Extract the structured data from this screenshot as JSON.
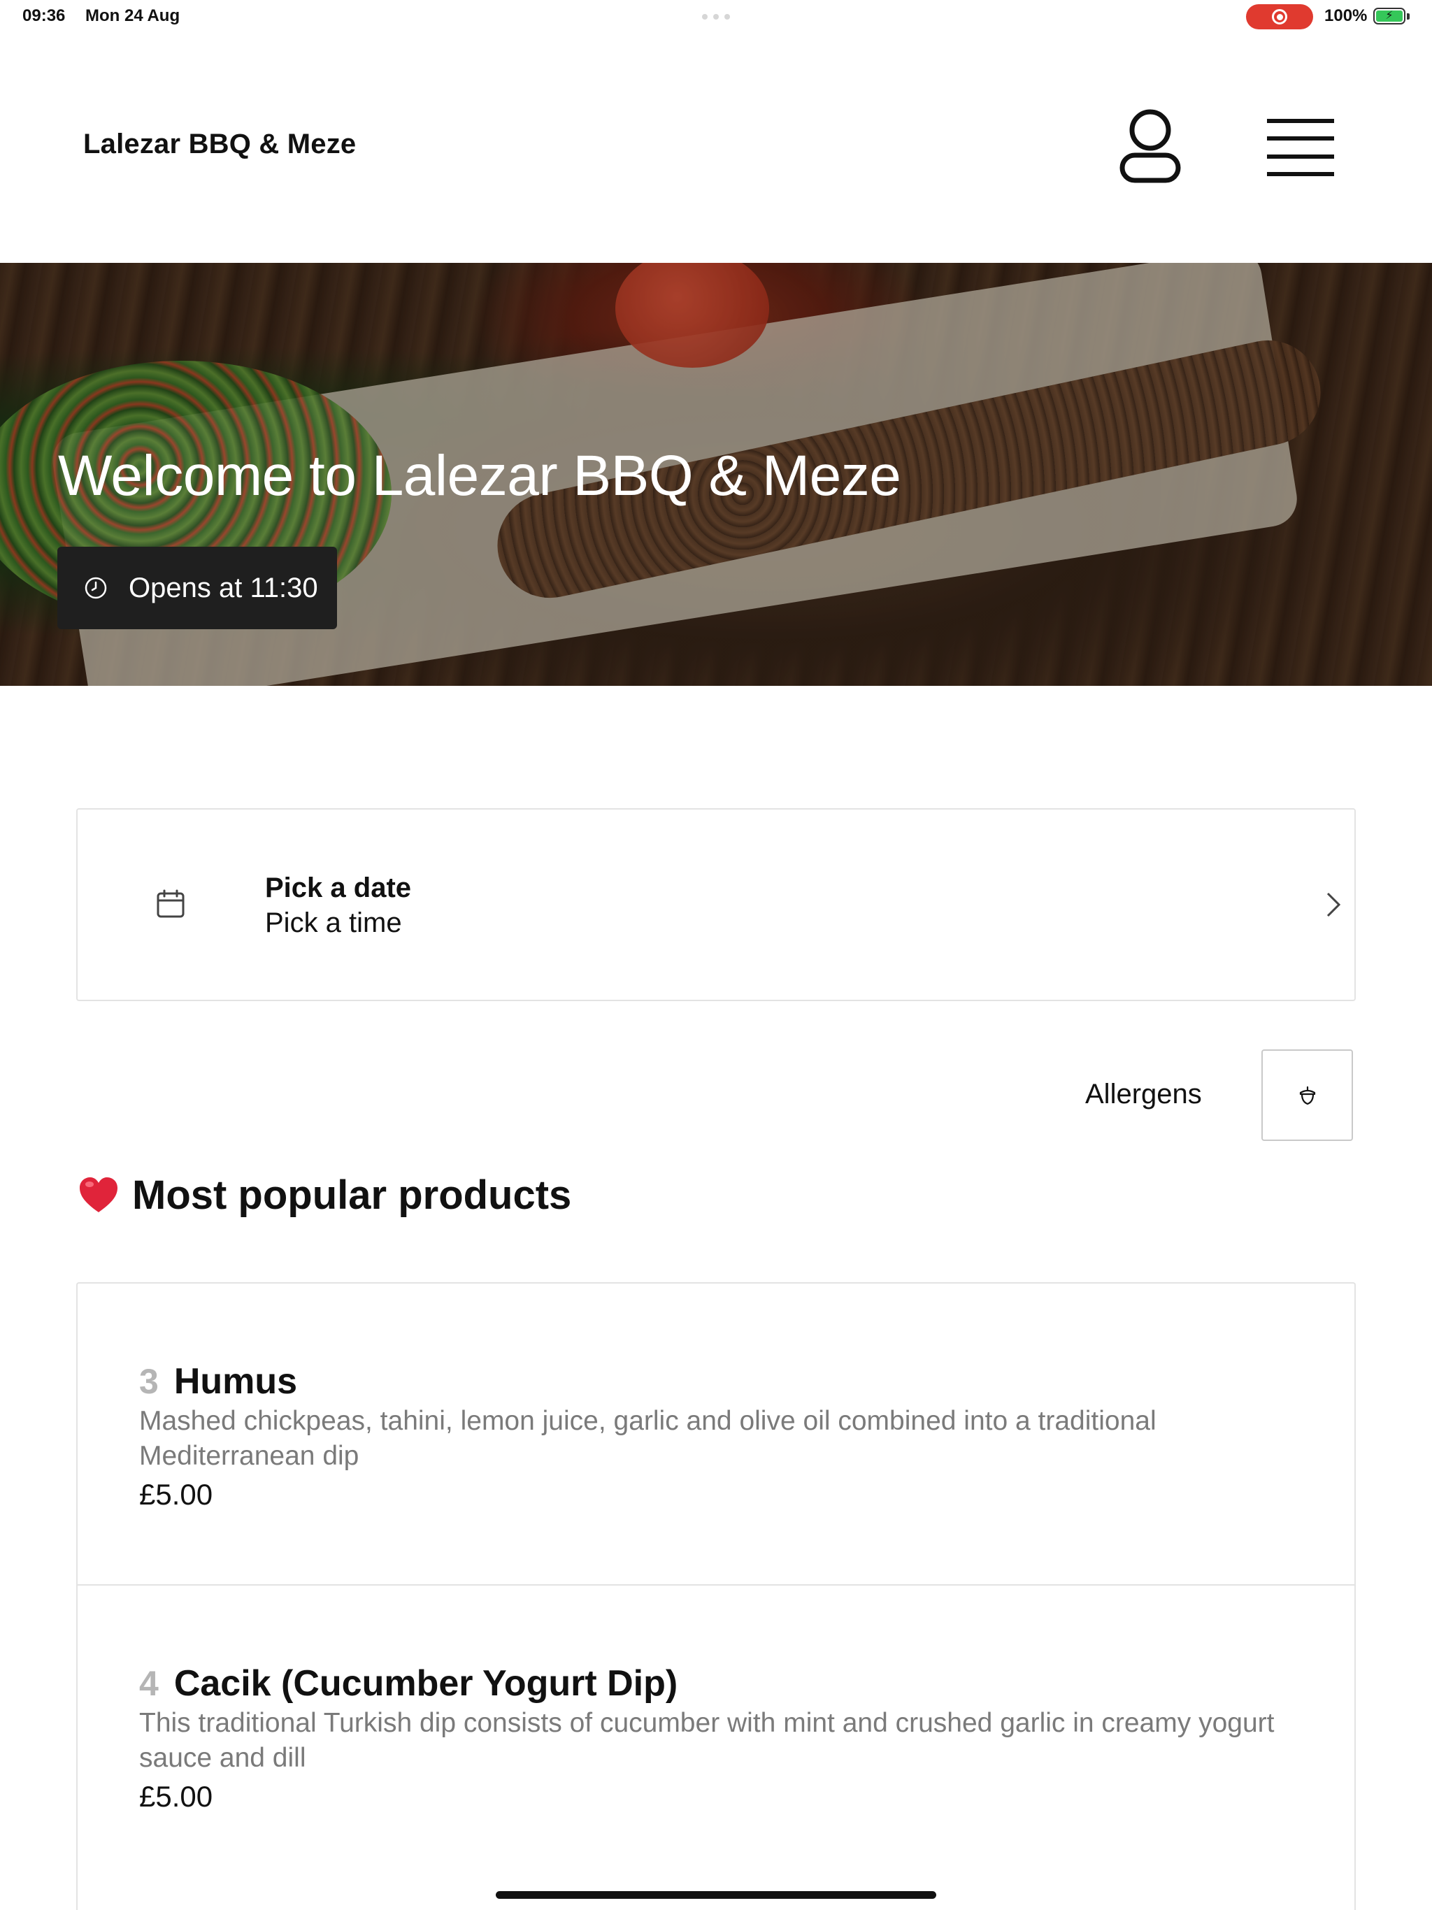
{
  "status_bar": {
    "time": "09:36",
    "date": "Mon 24 Aug",
    "battery": "100%",
    "record_color": "#e03a2f",
    "battery_color": "#35c759"
  },
  "header": {
    "brand": "Lalezar BBQ & Meze",
    "user_icon": "user-icon",
    "menu_icon": "hamburger-menu-icon"
  },
  "hero": {
    "title": "Welcome to Lalezar BBQ & Meze",
    "opens_label": "Opens at 11:30",
    "clock_icon": "clock-icon"
  },
  "schedule": {
    "date_label": "Pick a date",
    "time_label": "Pick a time",
    "calendar_icon": "calendar-icon",
    "chevron_icon": "chevron-right-icon"
  },
  "allergens": {
    "label": "Allergens",
    "icon": "acorn-icon"
  },
  "popular": {
    "title": "Most popular products",
    "heart_icon": "heart-icon",
    "heart_color": "#e0243a",
    "items": [
      {
        "number": "3",
        "name": "Humus",
        "description": "Mashed chickpeas, tahini, lemon juice, garlic and olive oil combined into a traditional Mediterranean dip",
        "price": "£5.00"
      },
      {
        "number": "4",
        "name": "Cacik (Cucumber Yogurt Dip)",
        "description": "This traditional Turkish dip consists of cucumber with mint and crushed garlic in creamy yogurt sauce and dill",
        "price": "£5.00"
      }
    ]
  }
}
